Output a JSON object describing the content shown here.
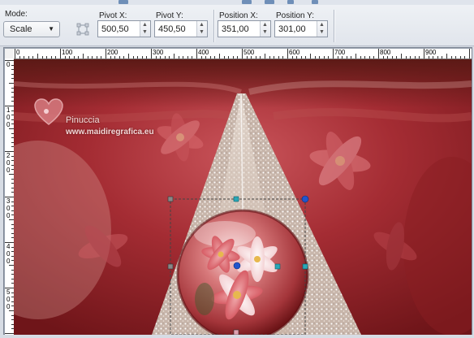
{
  "toolbar": {
    "mode_label": "Mode:",
    "mode_value": "Scale",
    "pivot_x_label": "Pivot X:",
    "pivot_x_value": "500,50",
    "pivot_y_label": "Pivot Y:",
    "pivot_y_value": "450,50",
    "position_x_label": "Position X:",
    "position_x_value": "351,00",
    "position_y_label": "Position Y:",
    "position_y_value": "301,00"
  },
  "ruler": {
    "top_labels": [
      "0",
      "100",
      "200",
      "300",
      "400",
      "500",
      "600",
      "700",
      "800",
      "900"
    ],
    "left_labels": [
      [
        "0"
      ],
      [
        "1",
        "0",
        "0"
      ],
      [
        "2",
        "0",
        "0"
      ],
      [
        "3",
        "0",
        "0"
      ],
      [
        "4",
        "0",
        "0"
      ],
      [
        "5",
        "0",
        "0"
      ]
    ]
  },
  "watermark": {
    "name": "Pinuccia",
    "url": "www.maidiregrafica.eu"
  },
  "colors": {
    "accent_handle": "#2aa7b7",
    "pivot_handle": "#2255cc",
    "background_red": "#9e2a2e"
  }
}
